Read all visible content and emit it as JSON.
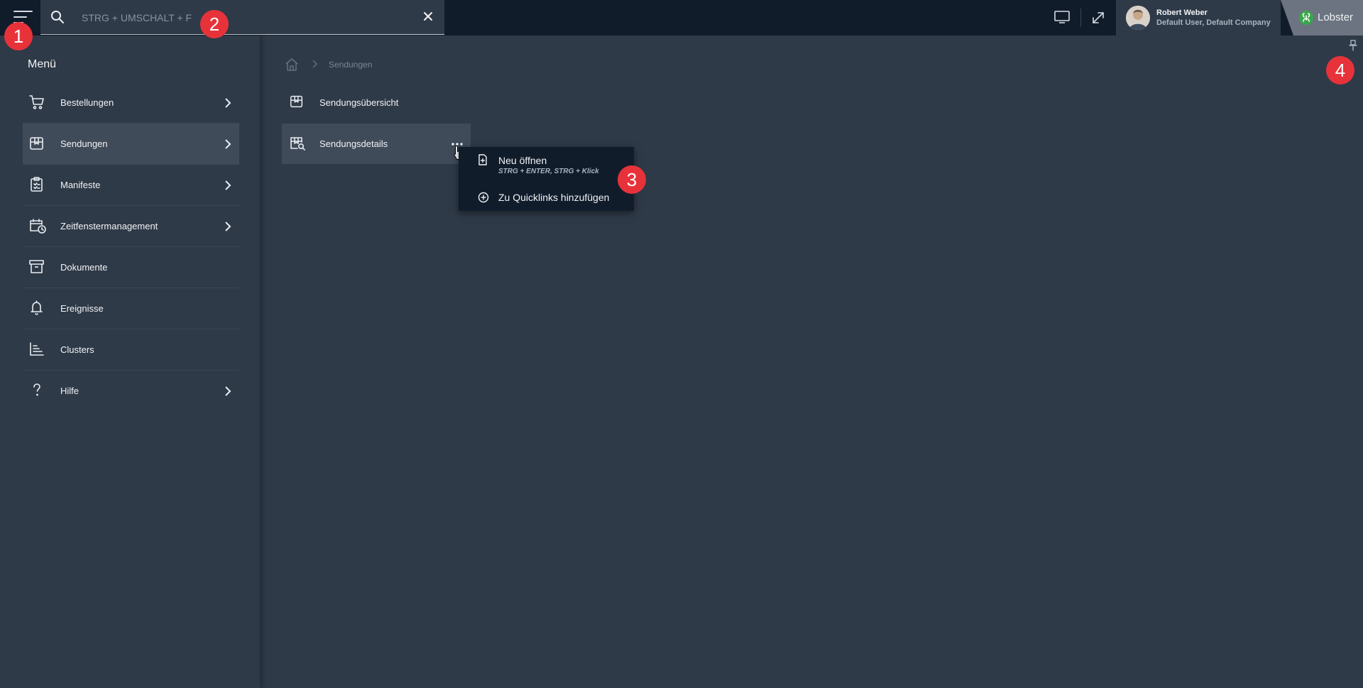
{
  "topbar": {
    "search": {
      "placeholder": "STRG + UMSCHALT + F",
      "value": ""
    },
    "user": {
      "name": "Robert Weber",
      "subtitle": "Default User, Default Company"
    },
    "brand": "Lobster"
  },
  "sidebar": {
    "title": "Menü",
    "items": [
      {
        "label": "Bestellungen",
        "icon": "cart-icon",
        "has_children": true
      },
      {
        "label": "Sendungen",
        "icon": "package-icon",
        "has_children": true,
        "active": true
      },
      {
        "label": "Manifeste",
        "icon": "clipboard-icon",
        "has_children": true
      },
      {
        "label": "Zeitfenstermanagement",
        "icon": "calendar-clock-icon",
        "has_children": true
      },
      {
        "label": "Dokumente",
        "icon": "archive-icon",
        "has_children": false
      },
      {
        "label": "Ereignisse",
        "icon": "bell-icon",
        "has_children": false
      },
      {
        "label": "Clusters",
        "icon": "bar-list-icon",
        "has_children": false
      },
      {
        "label": "Hilfe",
        "icon": "question-icon",
        "has_children": true
      }
    ]
  },
  "breadcrumb": {
    "current": "Sendungen"
  },
  "submenu": {
    "items": [
      {
        "label": "Sendungsübersicht",
        "icon": "package-icon"
      },
      {
        "label": "Sendungsdetails",
        "icon": "package-search-icon",
        "active": true
      }
    ]
  },
  "context_menu": {
    "items": [
      {
        "label": "Neu öffnen",
        "hint": "STRG + ENTER, STRG + Klick",
        "icon": "file-plus-icon"
      },
      {
        "label": "Zu Quicklinks hinzufügen",
        "icon": "plus-circle-icon"
      }
    ]
  },
  "annotations": [
    "1",
    "2",
    "3",
    "4"
  ]
}
